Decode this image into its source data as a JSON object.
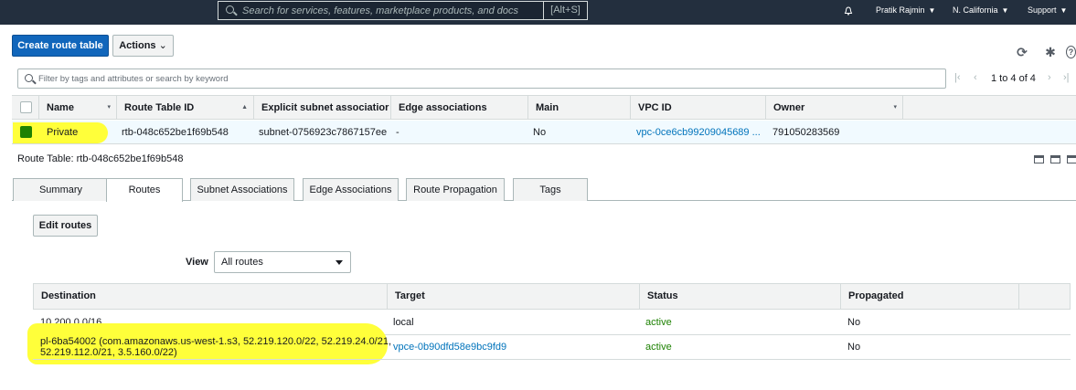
{
  "topnav": {
    "search_placeholder": "Search for services, features, marketplace products, and docs",
    "search_shortcut": "[Alt+S]",
    "user": "Pratik Rajmin",
    "region": "N. California",
    "support": "Support",
    "caret": "▼"
  },
  "toolbar": {
    "create_label": "Create route table",
    "actions_label": "Actions",
    "actions_caret": "⌄",
    "refresh_icon": "⟳",
    "settings_icon": "✱",
    "help_icon": "?"
  },
  "filter": {
    "placeholder": "Filter by tags and attributes or search by keyword"
  },
  "pagination": {
    "first": "|‹",
    "prev": "‹",
    "range": "1 to 4 of 4",
    "next": "›",
    "last": "›|"
  },
  "grid": {
    "columns": [
      "Name",
      "Route Table ID",
      "Explicit subnet associatior",
      "Edge associations",
      "Main",
      "VPC ID",
      "Owner"
    ],
    "sort_down": "▾",
    "sort_up": "▲",
    "row": {
      "name": "Private",
      "route_table_id": "rtb-048c652be1f69b548",
      "subnet": "subnet-0756923c7867157ee",
      "edge": "-",
      "main": "No",
      "vpc_id": "vpc-0ce6cb99209045689 ...",
      "owner": "791050283569"
    }
  },
  "details": {
    "label_prefix": "Route Table:",
    "label_value": "rtb-048c652be1f69b548",
    "tabs": [
      "Summary",
      "Routes",
      "Subnet Associations",
      "Edge Associations",
      "Route Propagation",
      "Tags"
    ],
    "active_tab": "Routes",
    "edit_routes_label": "Edit routes",
    "view_label": "View",
    "view_value": "All routes"
  },
  "routes": {
    "columns": [
      "Destination",
      "Target",
      "Status",
      "Propagated"
    ],
    "rows": [
      {
        "destination": "10.200.0.0/16",
        "target": "local",
        "status": "active",
        "propagated": "No"
      },
      {
        "destination_line1": "pl-6ba54002 (com.amazonaws.us-west-1.s3, 52.219.120.0/22, 52.219.24.0/21,",
        "destination_line2": "52.219.112.0/21, 3.5.160.0/22)",
        "target": "vpce-0b90dfd58e9bc9fd9",
        "status": "active",
        "propagated": "No"
      }
    ]
  },
  "colors": {
    "nav_bg": "#232f3e",
    "primary": "#1166bb",
    "link": "#0073bb",
    "status_active": "#1d8102",
    "highlight": "#ffff3a"
  }
}
